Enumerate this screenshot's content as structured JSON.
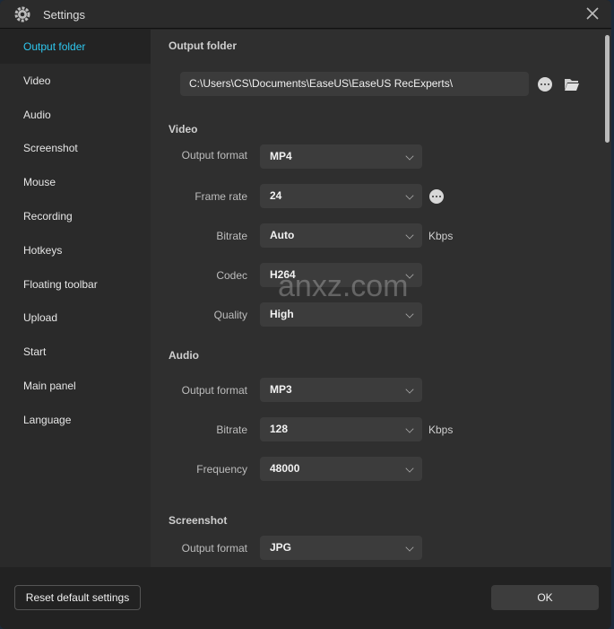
{
  "window": {
    "title": "Settings"
  },
  "sidebar": {
    "items": [
      {
        "label": "Output folder",
        "active": true
      },
      {
        "label": "Video"
      },
      {
        "label": "Audio"
      },
      {
        "label": "Screenshot"
      },
      {
        "label": "Mouse"
      },
      {
        "label": "Recording"
      },
      {
        "label": "Hotkeys"
      },
      {
        "label": "Floating toolbar"
      },
      {
        "label": "Upload"
      },
      {
        "label": "Start"
      },
      {
        "label": "Main panel"
      },
      {
        "label": "Language"
      }
    ]
  },
  "output_folder": {
    "heading": "Output folder",
    "path": "C:\\Users\\CS\\Documents\\EaseUS\\EaseUS RecExperts\\"
  },
  "video": {
    "heading": "Video",
    "output_format": {
      "label": "Output format",
      "value": "MP4"
    },
    "frame_rate": {
      "label": "Frame rate",
      "value": "24"
    },
    "bitrate": {
      "label": "Bitrate",
      "value": "Auto",
      "unit": "Kbps"
    },
    "codec": {
      "label": "Codec",
      "value": "H264"
    },
    "quality": {
      "label": "Quality",
      "value": "High"
    }
  },
  "audio": {
    "heading": "Audio",
    "output_format": {
      "label": "Output format",
      "value": "MP3"
    },
    "bitrate": {
      "label": "Bitrate",
      "value": "128",
      "unit": "Kbps"
    },
    "frequency": {
      "label": "Frequency",
      "value": "48000"
    }
  },
  "screenshot": {
    "heading": "Screenshot",
    "output_format": {
      "label": "Output format",
      "value": "JPG"
    }
  },
  "footer": {
    "reset_label": "Reset default settings",
    "ok_label": "OK"
  },
  "watermark": "anxz.com",
  "colors": {
    "accent": "#2ec8f0",
    "background": "#2f2f2f",
    "sidebar": "#2a2a2a"
  }
}
